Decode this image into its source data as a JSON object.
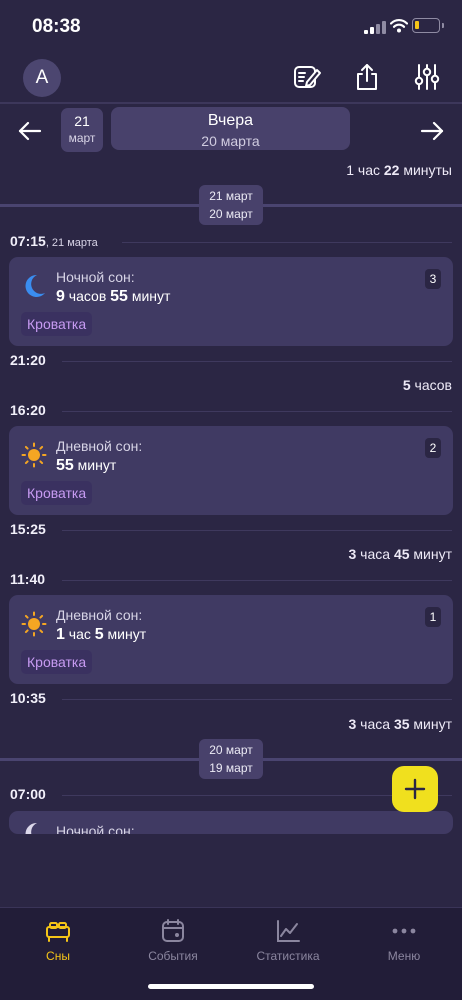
{
  "status_bar": {
    "time": "08:38"
  },
  "header": {
    "avatar_letter": "A"
  },
  "date_nav": {
    "prev_day": "21",
    "prev_month": "март",
    "day_title": "Вчера",
    "day_subtitle": "20 марта"
  },
  "timeline": {
    "gap_top": {
      "pre": "1 час ",
      "num": "22",
      "post": " минуты"
    },
    "sep1": {
      "top": "21 март",
      "bottom": "20 март"
    },
    "t1": {
      "time": "07:15",
      "date": ", 21 марта"
    },
    "card1": {
      "title": "Ночной сон:",
      "h": "9",
      "h_unit": " часов ",
      "m": "55",
      "m_unit": " минут",
      "badge": "3",
      "tag": "Кроватка"
    },
    "t2": "21:20",
    "gap2": {
      "num": "5",
      "unit": " часов"
    },
    "t3": "16:20",
    "card2": {
      "title": "Дневной сон:",
      "m": "55",
      "m_unit": " минут",
      "badge": "2",
      "tag": "Кроватка"
    },
    "t4": "15:25",
    "gap3": {
      "a": "3",
      "a_unit": " часа ",
      "b": "45",
      "b_unit": " минут"
    },
    "t5": "11:40",
    "card3": {
      "title": "Дневной сон:",
      "h": "1",
      "h_unit": " час ",
      "m": "5",
      "m_unit": " минут",
      "badge": "1",
      "tag": "Кроватка"
    },
    "t6": "10:35",
    "gap4": {
      "a": "3",
      "a_unit": " часа ",
      "b": "35",
      "b_unit": " минут"
    },
    "sep2": {
      "top": "20 март",
      "bottom": "19 март"
    },
    "t7": "07:00",
    "card4": {
      "title": "Ночной сон:"
    }
  },
  "icons": {
    "night": "moon-icon",
    "day": "sun-icon"
  },
  "colors": {
    "accent": "#f5c518",
    "fab": "#f0e01e",
    "tag": "#c79bf2",
    "moon": "#3a8df0",
    "sun": "#f5a623"
  },
  "tabs": [
    {
      "label": "Сны",
      "icon": "bed-icon",
      "active": true
    },
    {
      "label": "События",
      "icon": "calendar-icon",
      "active": false
    },
    {
      "label": "Статистика",
      "icon": "chart-icon",
      "active": false
    },
    {
      "label": "Меню",
      "icon": "more-icon",
      "active": false
    }
  ]
}
